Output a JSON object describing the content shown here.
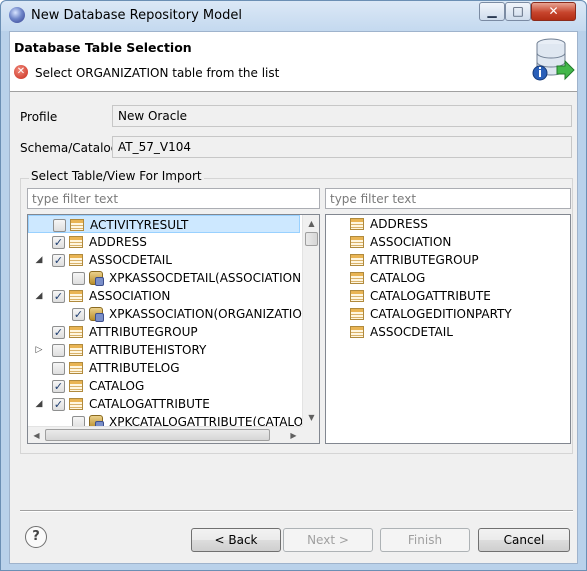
{
  "window": {
    "title": "New Database Repository Model"
  },
  "header": {
    "title": "Database Table Selection",
    "message": "Select ORGANIZATION table from the list"
  },
  "form": {
    "profile_label": "Profile",
    "profile_value": "New Oracle",
    "schema_label": "Schema/Catalog",
    "schema_value": "AT_57_V104"
  },
  "group": {
    "title": "Select Table/View For Import"
  },
  "filters": {
    "left_placeholder": "type filter text",
    "right_placeholder": "type filter text"
  },
  "tree": {
    "items": [
      {
        "label": "ACTIVITYRESULT",
        "checked": false,
        "expander": "",
        "icon": "table-icon",
        "level": 0,
        "selected": true
      },
      {
        "label": "ADDRESS",
        "checked": true,
        "expander": "",
        "icon": "table-icon",
        "level": 0,
        "selected": false
      },
      {
        "label": "ASSOCDETAIL",
        "checked": true,
        "expander": "expanded",
        "icon": "table-icon",
        "level": 0,
        "selected": false
      },
      {
        "label": "XPKASSOCDETAIL(ASSOCIATION)",
        "checked": false,
        "expander": "",
        "icon": "index-icon",
        "level": 1,
        "selected": false
      },
      {
        "label": "ASSOCIATION",
        "checked": true,
        "expander": "expanded",
        "icon": "table-icon",
        "level": 0,
        "selected": false
      },
      {
        "label": "XPKASSOCIATION(ORGANIZATION)",
        "checked": true,
        "expander": "",
        "icon": "index-icon",
        "level": 1,
        "selected": false
      },
      {
        "label": "ATTRIBUTEGROUP",
        "checked": true,
        "expander": "",
        "icon": "table-icon",
        "level": 0,
        "selected": false
      },
      {
        "label": "ATTRIBUTEHISTORY",
        "checked": false,
        "expander": "collapsed",
        "icon": "table-icon",
        "level": 0,
        "selected": false
      },
      {
        "label": "ATTRIBUTELOG",
        "checked": false,
        "expander": "",
        "icon": "table-icon",
        "level": 0,
        "selected": false
      },
      {
        "label": "CATALOG",
        "checked": true,
        "expander": "",
        "icon": "table-icon",
        "level": 0,
        "selected": false
      },
      {
        "label": "CATALOGATTRIBUTE",
        "checked": true,
        "expander": "expanded",
        "icon": "table-icon",
        "level": 0,
        "selected": false
      },
      {
        "label": "XPKCATALOGATTRIBUTE(CATALOG",
        "checked": false,
        "expander": "",
        "icon": "index-icon",
        "level": 1,
        "selected": false
      }
    ]
  },
  "selected_list": {
    "items": [
      "ADDRESS",
      "ASSOCIATION",
      "ATTRIBUTEGROUP",
      "CATALOG",
      "CATALOGATTRIBUTE",
      "CATALOGEDITIONPARTY",
      "ASSOCDETAIL"
    ]
  },
  "buttons": {
    "back": "< Back",
    "next": "Next >",
    "finish": "Finish",
    "cancel": "Cancel",
    "help": "?"
  },
  "window_controls": {
    "minimize": "▁",
    "maximize": "□",
    "close": "✕"
  },
  "icons": {
    "error": "✕",
    "check": "✓",
    "expanded": "◢",
    "collapsed": "▷",
    "scroll_up": "▲",
    "scroll_down": "▼",
    "scroll_left": "◀",
    "scroll_right": "▶"
  }
}
